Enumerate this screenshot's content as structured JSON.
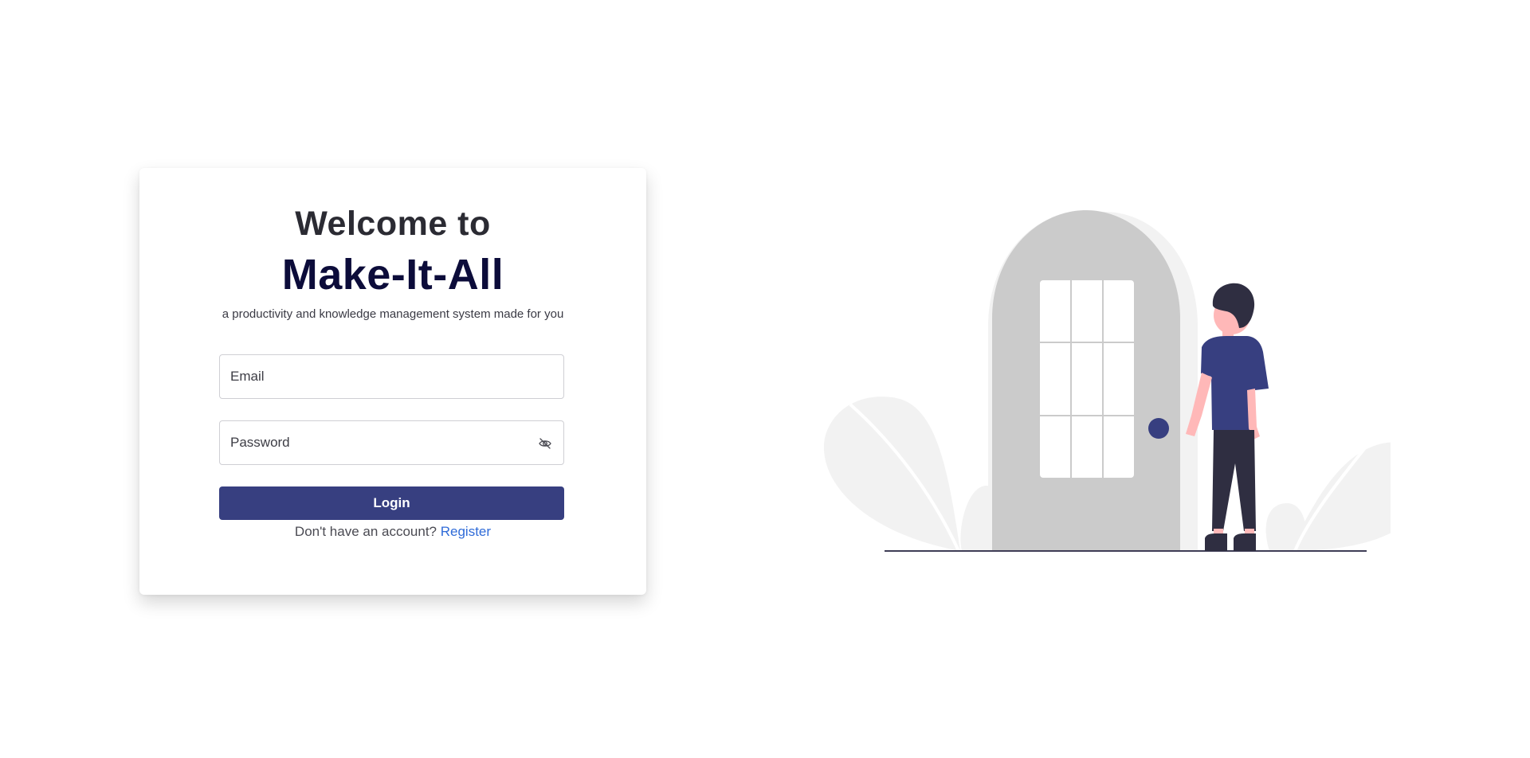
{
  "login_card": {
    "heading_line1": "Welcome to",
    "heading_brand": "Make-It-All",
    "tagline": "a productivity and knowledge management system made for you",
    "email_placeholder": "Email",
    "password_placeholder": "Password",
    "password_toggle_icon": "eye-off-icon",
    "login_label": "Login",
    "register_prompt": "Don't have an account?",
    "register_link": "Register"
  },
  "illustration": {
    "subject": "person standing at an arched door",
    "icon": "door-illustration"
  },
  "colors": {
    "accent": "#373f80",
    "brand_text": "#0c0c3a",
    "link": "#2f6bd8"
  }
}
